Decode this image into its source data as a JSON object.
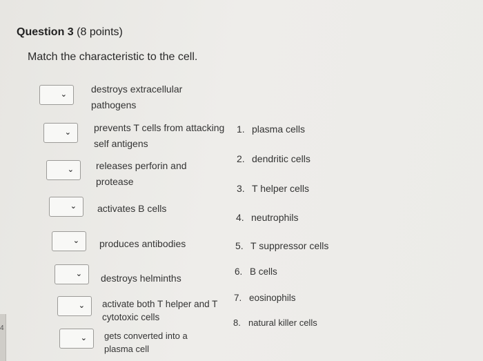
{
  "question": {
    "title": "Question 3",
    "points": "(8 points)",
    "prompt": "Match the characteristic to the cell."
  },
  "characteristics": [
    {
      "text": "destroys extracellular pathogens",
      "selected": ""
    },
    {
      "text": "prevents T cells from attacking self antigens",
      "selected": ""
    },
    {
      "text": "releases perforin and protease",
      "selected": ""
    },
    {
      "text": "activates B cells",
      "selected": ""
    },
    {
      "text": "produces antibodies",
      "selected": ""
    },
    {
      "text": "destroys helminths",
      "selected": ""
    },
    {
      "text": "activate both T helper and T cytotoxic cells",
      "selected": ""
    },
    {
      "text": "gets converted into a plasma cell",
      "selected": ""
    }
  ],
  "options": [
    {
      "num": "1.",
      "label": "plasma cells"
    },
    {
      "num": "2.",
      "label": "dendritic cells"
    },
    {
      "num": "3.",
      "label": "T helper cells"
    },
    {
      "num": "4.",
      "label": "neutrophils"
    },
    {
      "num": "5.",
      "label": "T suppressor cells"
    },
    {
      "num": "6.",
      "label": "B cells"
    },
    {
      "num": "7.",
      "label": "eosinophils"
    },
    {
      "num": "8.",
      "label": "natural killer cells"
    }
  ],
  "dropdown_icon": "chevron-down-icon",
  "edge_number": "4"
}
